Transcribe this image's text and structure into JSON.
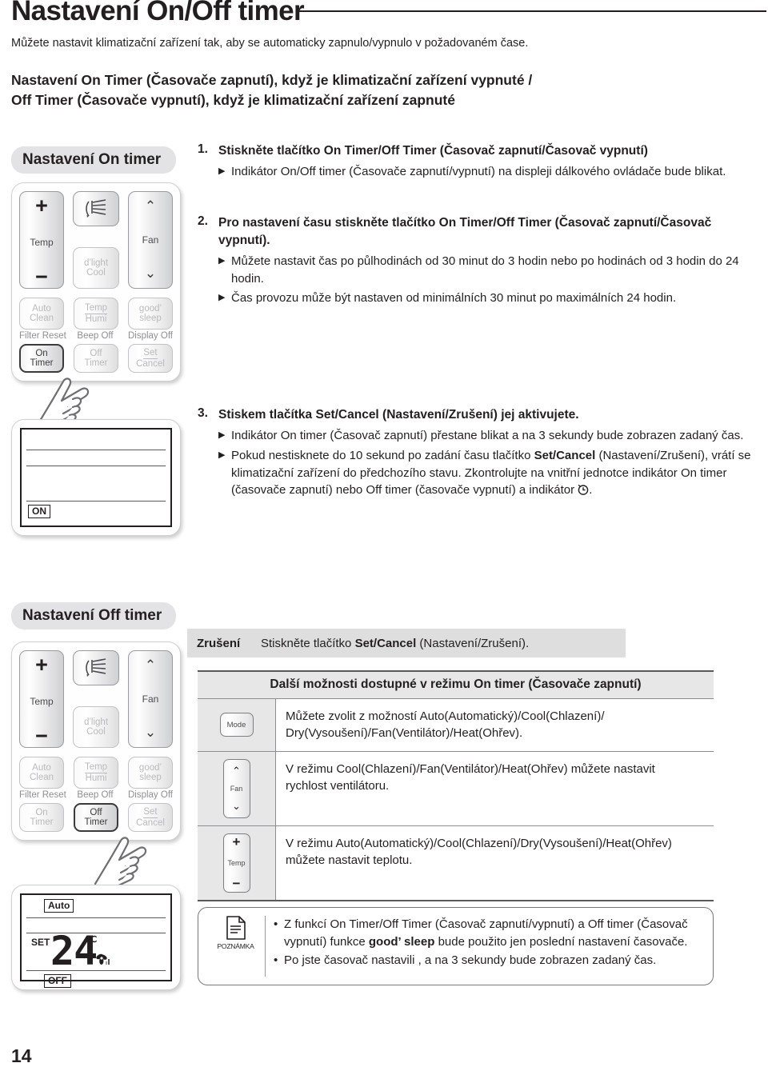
{
  "header": {
    "title": "Nastavení On/Off timer",
    "intro": "Můžete nastavit klimatizační zařízení tak, aby se automaticky zapnulo/vypnulo v požadovaném čase.",
    "lead_line1": "Nastavení On Timer (Časovače zapnutí), když je klimatizační zařízení vypnuté /",
    "lead_line2": "Off Timer (Časovače vypnutí), když je klimatizační zařízení zapnuté"
  },
  "sections": {
    "on_timer_banner": "Nastavení On timer",
    "off_timer_banner": "Nastavení Off timer"
  },
  "remote": {
    "temp_label": "Temp",
    "plus": "+",
    "minus": "−",
    "fan_label": "Fan",
    "chevron_up": "⌃",
    "chevron_down": "⌄",
    "dlight_line1": "d’light",
    "dlight_line2": "Cool",
    "auto_line1": "Auto",
    "auto_line2": "Clean",
    "temphumi_line1": "Temp",
    "temphumi_line2": "Humi",
    "goodsleep_line1": "good’",
    "goodsleep_line2": "sleep",
    "caption_filter_reset": "Filter Reset",
    "caption_beep_off": "Beep Off",
    "caption_display_off": "Display Off",
    "on_line1": "On",
    "on_line2": "Timer",
    "off_line1": "Off",
    "off_line2": "Timer",
    "set_line1": "Set",
    "set_line2": "Cancel"
  },
  "lcd_on": {
    "indicator": "ON"
  },
  "lcd_off": {
    "mode": "Auto",
    "set_label": "SET",
    "temperature": "24",
    "degree": "℃",
    "indicator": "OFF"
  },
  "steps": [
    {
      "num": "1.",
      "title": "Stiskněte tlačítko On Timer/Off Timer (Časovač zapnutí/Časovač vypnutí)",
      "bullets": [
        "Indikátor On/Off timer (Časovače zapnutí/vypnutí) na displeji dálkového ovládače bude blikat."
      ]
    },
    {
      "num": "2.",
      "title": "Pro nastavení času stiskněte tlačítko On Timer/Off Timer (Časovač zapnutí/Časovač vypnutí).",
      "bullets": [
        "Můžete nastavit čas po půlhodinách od 30 minut do 3 hodin nebo po hodinách od 3 hodin do 24 hodin.",
        "Čas provozu může být nastaven od minimálních 30 minut po maximálních 24 hodin."
      ]
    }
  ],
  "step3": {
    "num": "3.",
    "title_a": "Stiskem tlačítka ",
    "title_b": "Set/Cancel",
    "title_c": " (Nastavení/Zrušení) jej aktivujete.",
    "bullet1": "Indikátor On timer (Časovač zapnutí) přestane blikat a na 3 sekundy bude zobrazen zadaný čas.",
    "bullet2_a": "Pokud nestisknete do 10 sekund po zadání času tlačítko ",
    "bullet2_b": "Set/Cancel",
    "bullet2_c": " (Nastavení/Zrušení), vrátí se klimatizační zařízení do předchozího stavu. Zkontrolujte na vnitřní jednotce indikátor On timer (časovače zapnutí) nebo Off timer (časovače vypnutí) a indikátor ",
    "bullet2_d": "."
  },
  "cancel": {
    "label": "Zrušení",
    "text_a": "Stiskněte tlačítko ",
    "text_b": "Set/Cancel",
    "text_c": " (Nastavení/Zrušení)."
  },
  "options": {
    "head": "Další možnosti dostupné v režimu On timer (Časovače zapnutí)",
    "rows": [
      {
        "icon": "mode-button",
        "icon_label": "Mode",
        "line1": "Můžete zvolit z možností Auto(Automatický)/Cool(Chlazení)/",
        "line2": "Dry(Vysoušení)/Fan(Ventilátor)/Heat(Ohřev)."
      },
      {
        "icon": "fan-button",
        "icon_label": "Fan",
        "line1": "V režimu Cool(Chlazení)/Fan(Ventilátor)/Heat(Ohřev) můžete nastavit",
        "line2": "rychlost ventilátoru."
      },
      {
        "icon": "temp-button",
        "icon_label": "Temp",
        "line1": "V režimu Auto(Automatický)/Cool(Chlazení)/Dry(Vysoušení)/Heat(Ohřev)",
        "line2": "můžete nastavit teplotu."
      }
    ]
  },
  "note": {
    "label": "POZNÁMKA",
    "item1_a": "Z funkcí On Timer/Off Timer (Časovač zapnutí/vypnutí) a Off timer (Časovač vypnutí) funkce ",
    "item1_b": "good’ sleep",
    "item1_c": " bude použito jen poslední nastavení časovače.",
    "item2": "Po jste časovač nastavili , a na 3 sekundy bude zobrazen zadaný čas."
  },
  "footer": {
    "page_number": "14"
  },
  "colors": {
    "ink": "#231f20",
    "banner_gray": "#e3e3e5",
    "strip_gray": "#dededf",
    "table_head_gray": "#e7e7e8",
    "key_gray": "#b9babd"
  }
}
